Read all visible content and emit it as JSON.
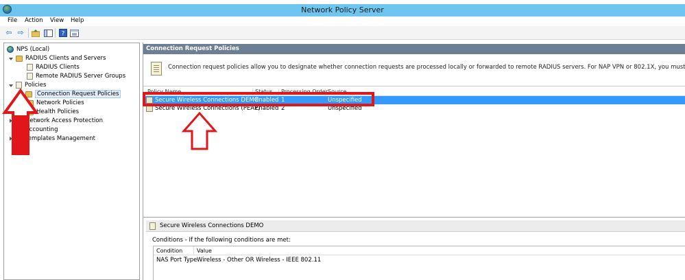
{
  "window": {
    "title": "Network Policy Server",
    "app_icon": "nps-globe-icon"
  },
  "menu": {
    "items": [
      "File",
      "Action",
      "View",
      "Help"
    ]
  },
  "toolbar": {
    "buttons": [
      "back-arrow-icon",
      "forward-arrow-icon",
      "up-folder-icon",
      "show-hide-tree-icon",
      "help-icon",
      "properties-icon"
    ]
  },
  "tree": {
    "root": "NPS (Local)",
    "nodes": {
      "radius_clients_servers": "RADIUS Clients and Servers",
      "radius_clients": "RADIUS Clients",
      "remote_radius_groups": "Remote RADIUS Server Groups",
      "policies": "Policies",
      "connection_request_policies": "Connection Request Policies",
      "network_policies": "Network Policies",
      "health_policies": "Health Policies",
      "nap": "Network Access Protection",
      "accounting": "Accounting",
      "templates": "Templates Management"
    }
  },
  "main": {
    "header": "Connection Request Policies",
    "description": "Connection request policies allow you to designate whether connection requests are processed locally or forwarded to remote RADIUS servers. For NAP VPN or 802.1X, you must configure PEAP authentication in connection request policy.",
    "columns": {
      "policy_name": "Policy Name",
      "status": "Status",
      "processing_order": "Processing Order",
      "source": "Source"
    },
    "rows": [
      {
        "name": "Secure Wireless Connections DEMO",
        "status": "Enabled",
        "order": "1",
        "source": "Unspecified"
      },
      {
        "name": "Secure Wireless Connections (PEAP)",
        "status": "Enabled",
        "order": "2",
        "source": "Unspecified"
      }
    ]
  },
  "detail": {
    "title": "Secure Wireless Connections DEMO",
    "conditions_label": "Conditions - If the following conditions are met:",
    "columns": {
      "condition": "Condition",
      "value": "Value"
    },
    "row": {
      "condition": "NAS Port Type",
      "value": "Wireless - Other OR Wireless - IEEE 802.11"
    }
  },
  "annotation_color": "#e0161b"
}
